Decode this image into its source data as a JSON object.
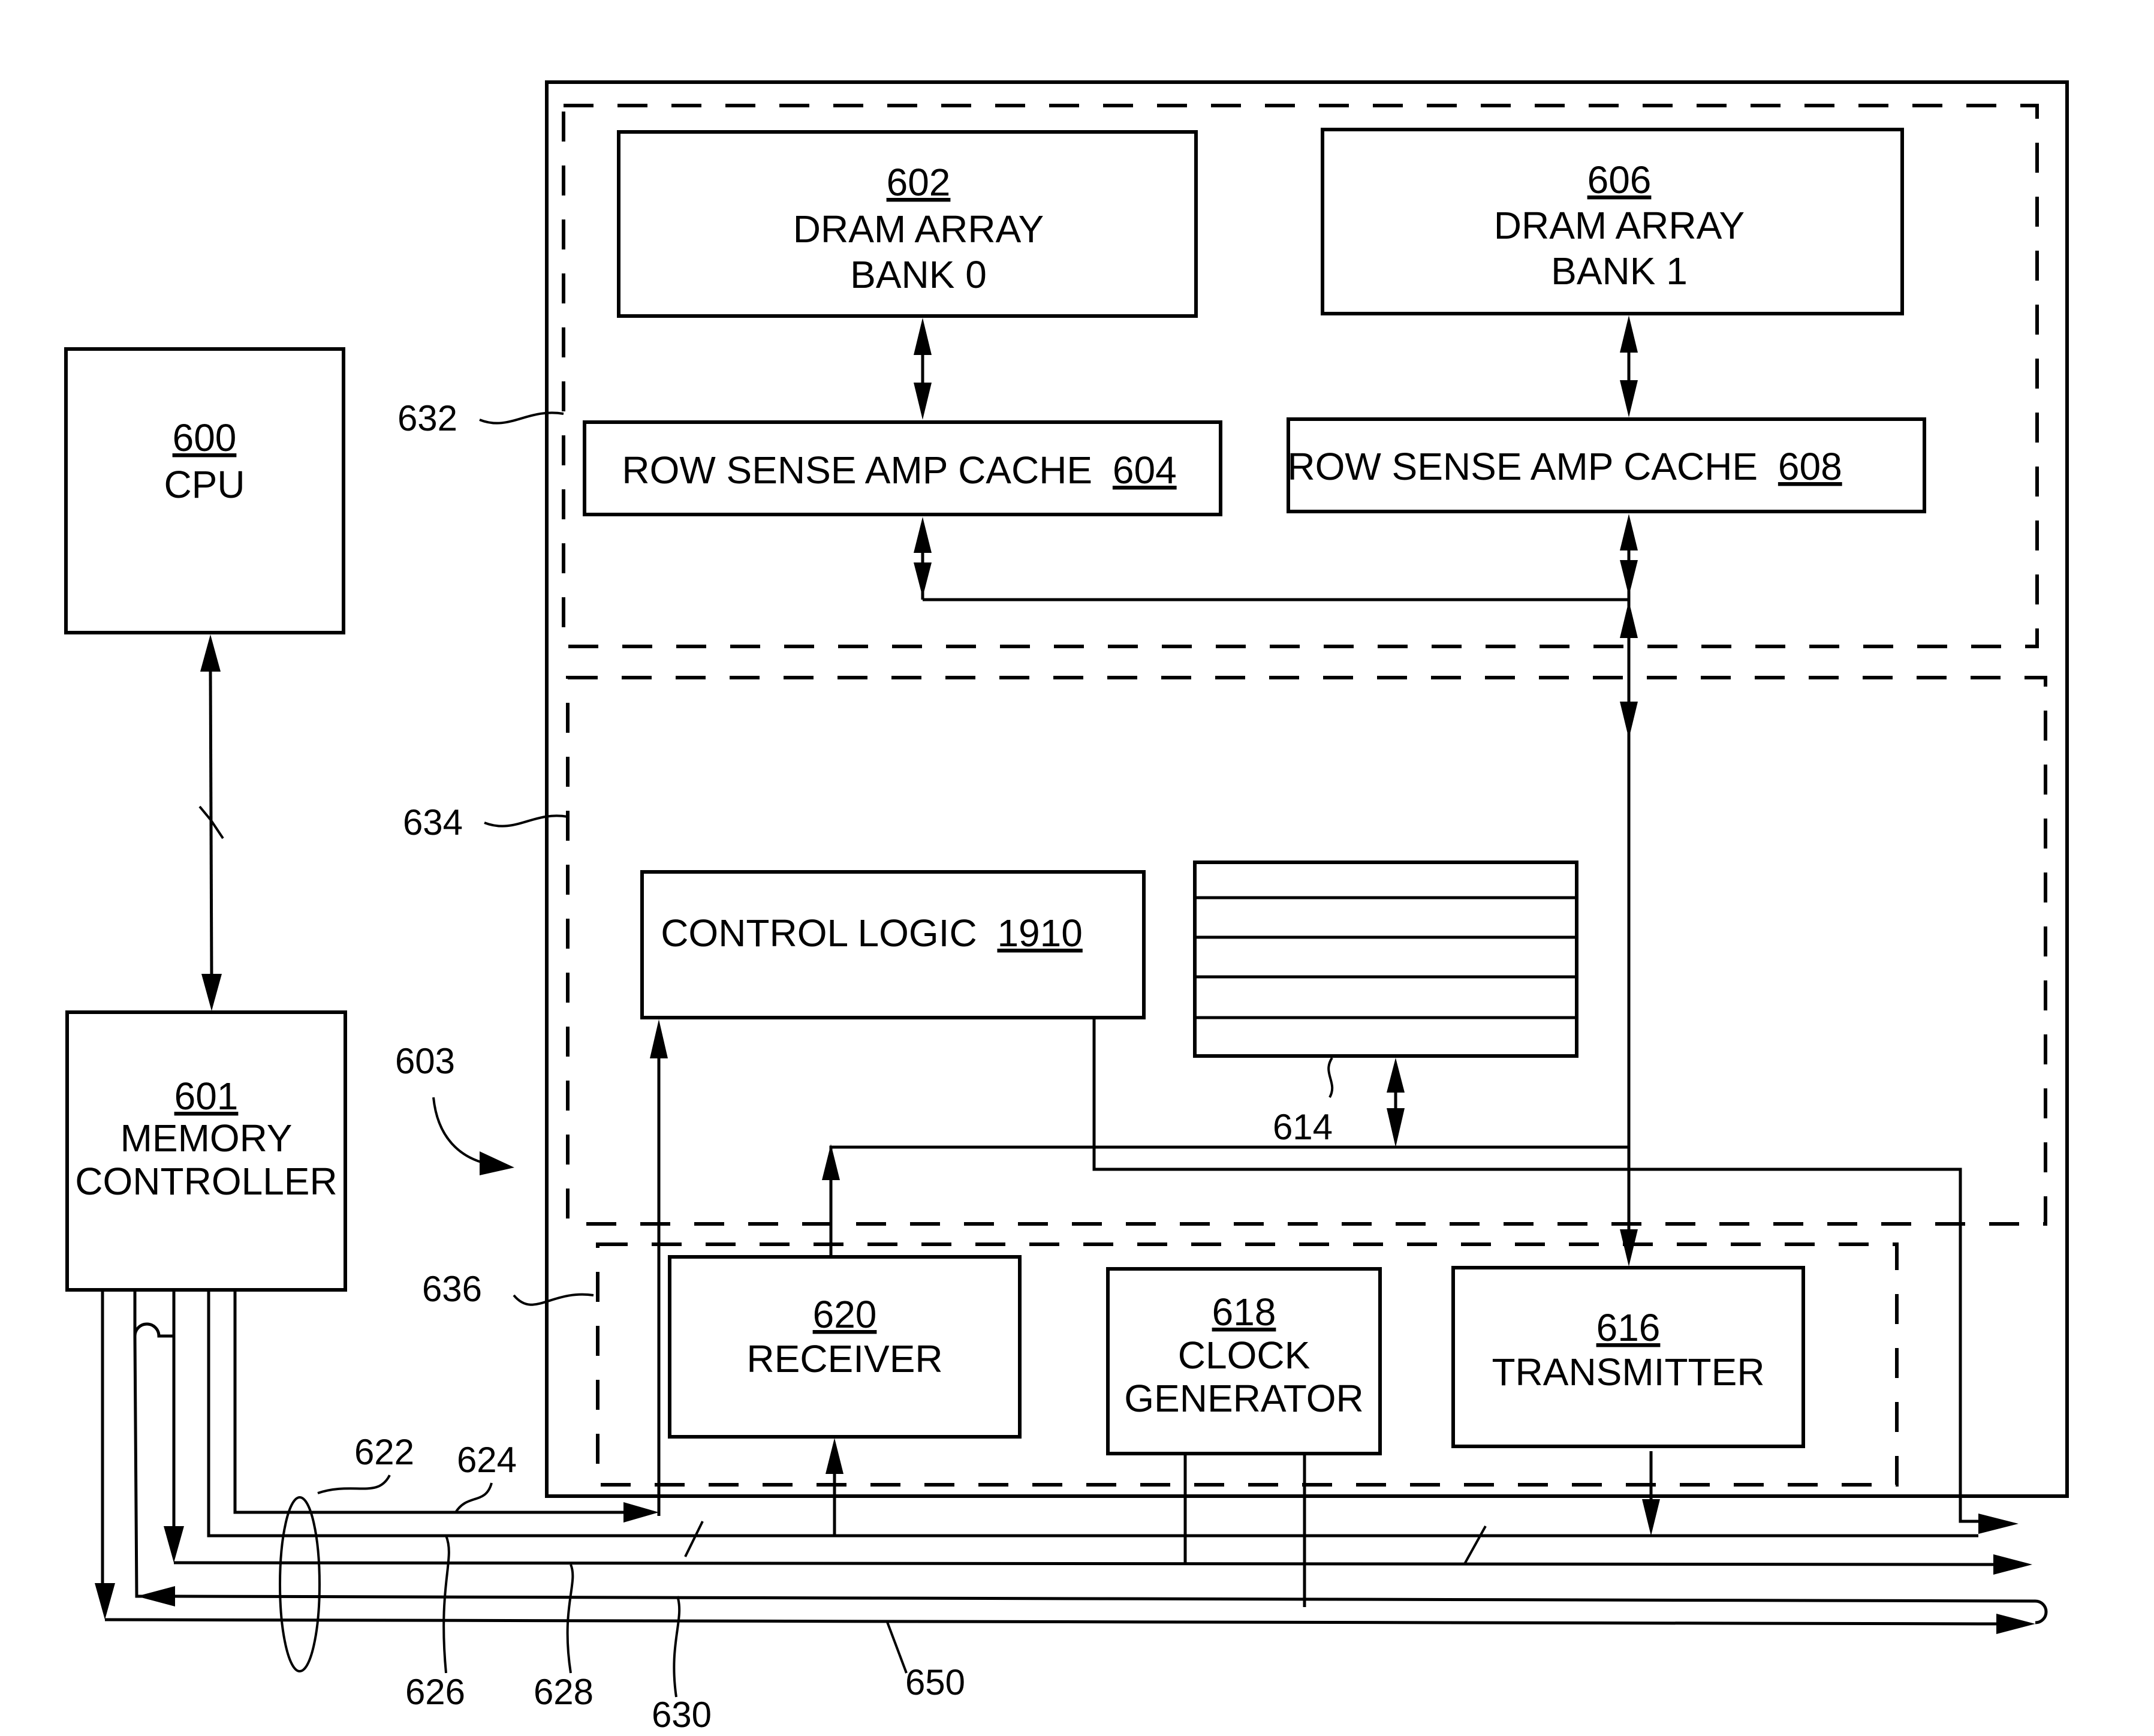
{
  "figure": {
    "blocks": {
      "cpu": {
        "ref": "600",
        "lines": [
          "CPU"
        ]
      },
      "memory_controller": {
        "ref": "601",
        "lines": [
          "MEMORY",
          "CONTROLLER"
        ]
      },
      "dram_bank0": {
        "ref": "602",
        "lines": [
          "DRAM ARRAY",
          "BANK 0"
        ]
      },
      "dram_bank1": {
        "ref": "606",
        "lines": [
          "DRAM ARRAY",
          "BANK 1"
        ]
      },
      "row_cache_0": {
        "label": "ROW SENSE AMP CACHE",
        "ref": "604"
      },
      "row_cache_1": {
        "label": "ROW SENSE AMP CACHE",
        "ref": "608"
      },
      "control_logic": {
        "label": "CONTROL LOGIC",
        "ref": "1910"
      },
      "receiver": {
        "ref": "620",
        "lines": [
          "RECEIVER"
        ]
      },
      "clock_generator": {
        "ref": "618",
        "lines": [
          "CLOCK",
          "GENERATOR"
        ]
      },
      "transmitter": {
        "ref": "616",
        "lines": [
          "TRANSMITTER"
        ]
      },
      "register_file": {
        "ref": "614",
        "rows": 5
      }
    },
    "reference_labels": {
      "region_632": "632",
      "region_634": "634",
      "device_603": "603",
      "region_636": "636",
      "bus_622": "622",
      "line_624": "624",
      "line_626": "626",
      "line_628": "628",
      "line_630": "630",
      "line_650": "650"
    }
  }
}
